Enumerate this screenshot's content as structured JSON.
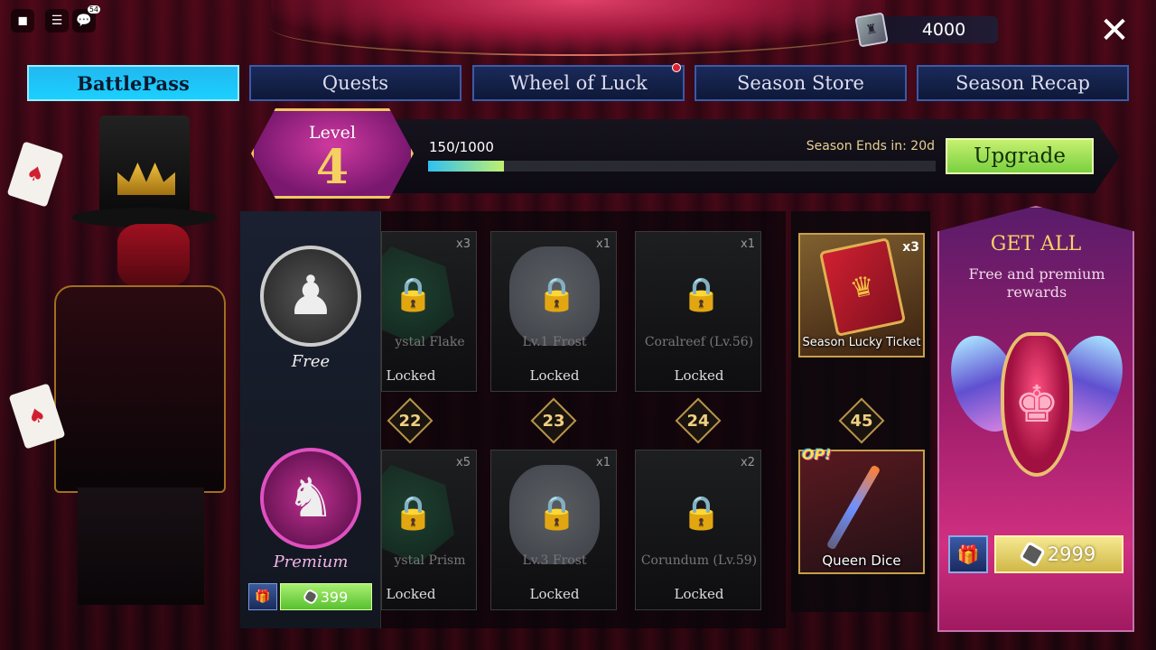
{
  "system": {
    "roblox_icon": "roblox-logo-icon",
    "menu_icon": "hamburger-menu-icon",
    "chat_icon": "chat-icon",
    "chat_badge": "54"
  },
  "currency": {
    "icon": "ticket-currency-icon",
    "amount": "4000"
  },
  "close": {
    "label": "✕",
    "icon": "close-icon"
  },
  "tabs": [
    {
      "label": "BattlePass",
      "active": true
    },
    {
      "label": "Quests",
      "active": false
    },
    {
      "label": "Wheel of Luck",
      "active": false,
      "notification": true
    },
    {
      "label": "Season Store",
      "active": false
    },
    {
      "label": "Season Recap",
      "active": false
    }
  ],
  "level": {
    "label": "Level",
    "value": "4",
    "xp_text": "150/1000",
    "xp_fraction": 0.15,
    "season_ends": "Season Ends in: 20d",
    "upgrade_label": "Upgrade"
  },
  "tracks": {
    "free_label": "Free",
    "premium_label": "Premium",
    "premium_price": "399"
  },
  "rewards": {
    "free": [
      {
        "name": "ystal Flake",
        "qty": "x3",
        "status": "Locked",
        "art": "green"
      },
      {
        "name": "Lv.1 Frost",
        "qty": "x1",
        "status": "Locked",
        "art": "white"
      },
      {
        "name": "Coralreef (Lv.56)",
        "qty": "x1",
        "status": "Locked",
        "art": "dark"
      }
    ],
    "levels": [
      "22",
      "23",
      "24"
    ],
    "premium": [
      {
        "name": "ystal Prism",
        "qty": "x5",
        "status": "Locked",
        "art": "green"
      },
      {
        "name": "Lv.3 Frost",
        "qty": "x1",
        "status": "Locked",
        "art": "white"
      },
      {
        "name": "Corundum (Lv.59)",
        "qty": "x2",
        "status": "Locked",
        "art": "dark"
      }
    ]
  },
  "featured": {
    "ticket": {
      "name": "Season Lucky Ticket",
      "qty": "x3"
    },
    "level": "45",
    "dice": {
      "name": "Queen Dice",
      "badge": "OP!"
    }
  },
  "get_all": {
    "title": "GET ALL",
    "subtitle": "Free and premium rewards",
    "price": "2999"
  },
  "colors": {
    "active_tab": "#22b8f0",
    "upgrade": "#9ae050",
    "gold": "#f0c860",
    "premium_pink": "#d03080"
  }
}
